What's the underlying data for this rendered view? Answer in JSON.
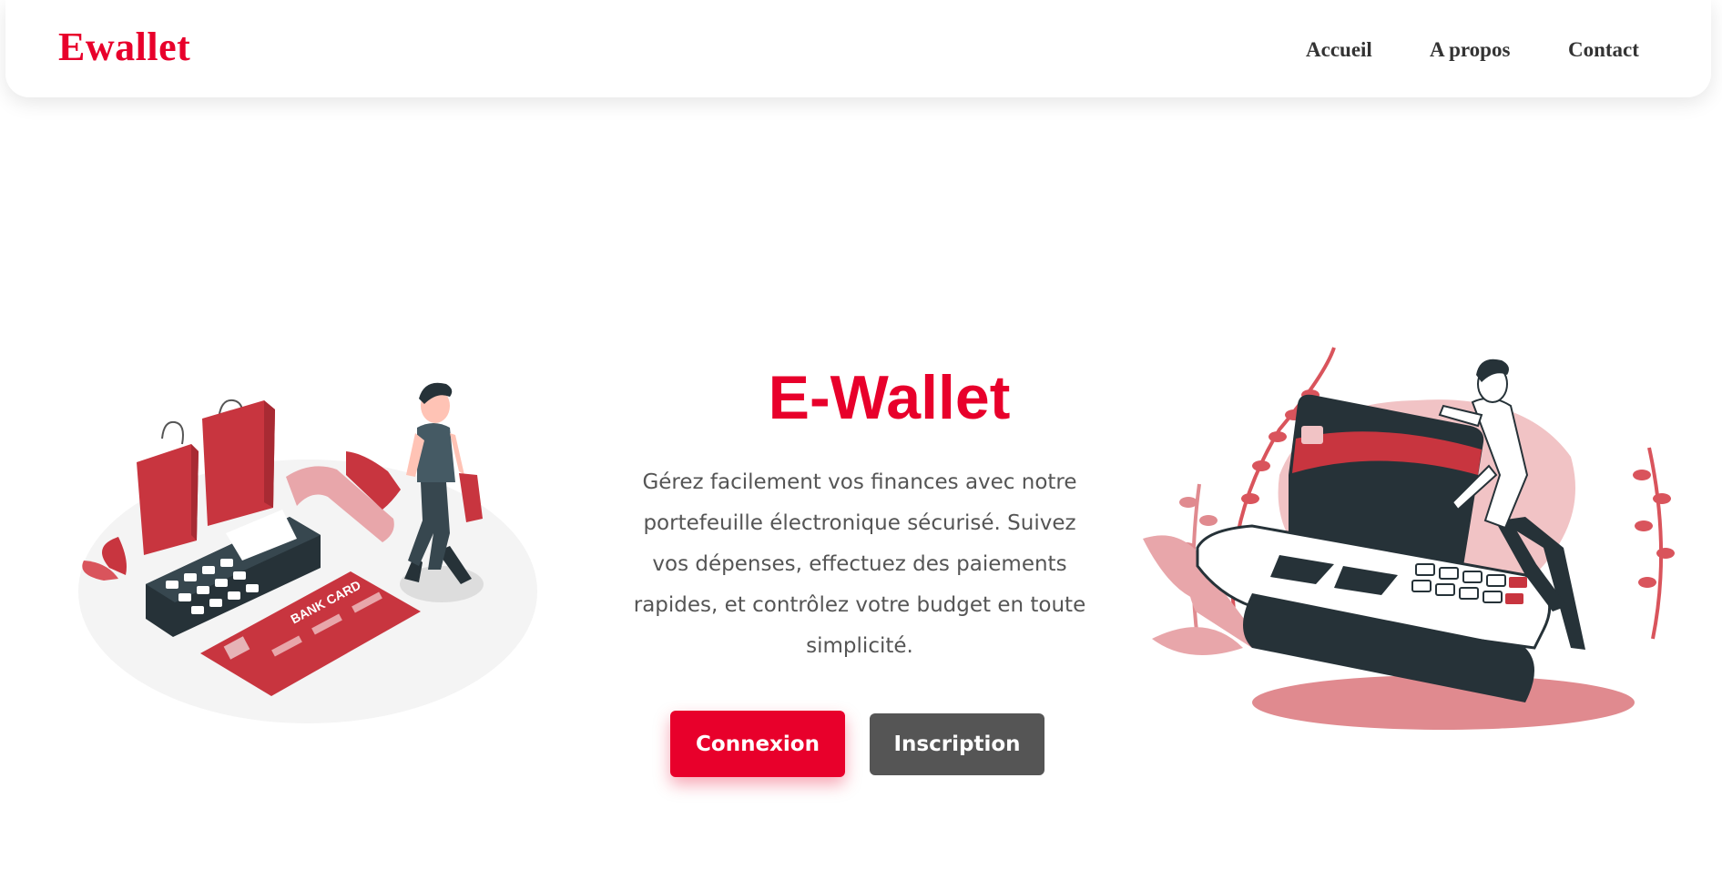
{
  "navbar": {
    "logo": "Ewallet",
    "links": [
      {
        "label": "Accueil"
      },
      {
        "label": "A propos"
      },
      {
        "label": "Contact"
      }
    ]
  },
  "hero": {
    "title": "E-Wallet",
    "description": "Gérez facilement vos finances avec notre portefeuille électronique sécurisé. Suivez vos dépenses, effectuez des paiements rapides, et contrôlez votre budget en toute simplicité.",
    "primary_button": "Connexion",
    "secondary_button": "Inscription"
  },
  "illustrations": {
    "left_card_text": "BANK CARD"
  },
  "colors": {
    "brand": "#e8002b",
    "secondary_button": "#555555",
    "text": "#555555",
    "illustration_red": "#c8353f",
    "illustration_dark": "#263238",
    "illustration_pink": "#e8a6aa"
  }
}
